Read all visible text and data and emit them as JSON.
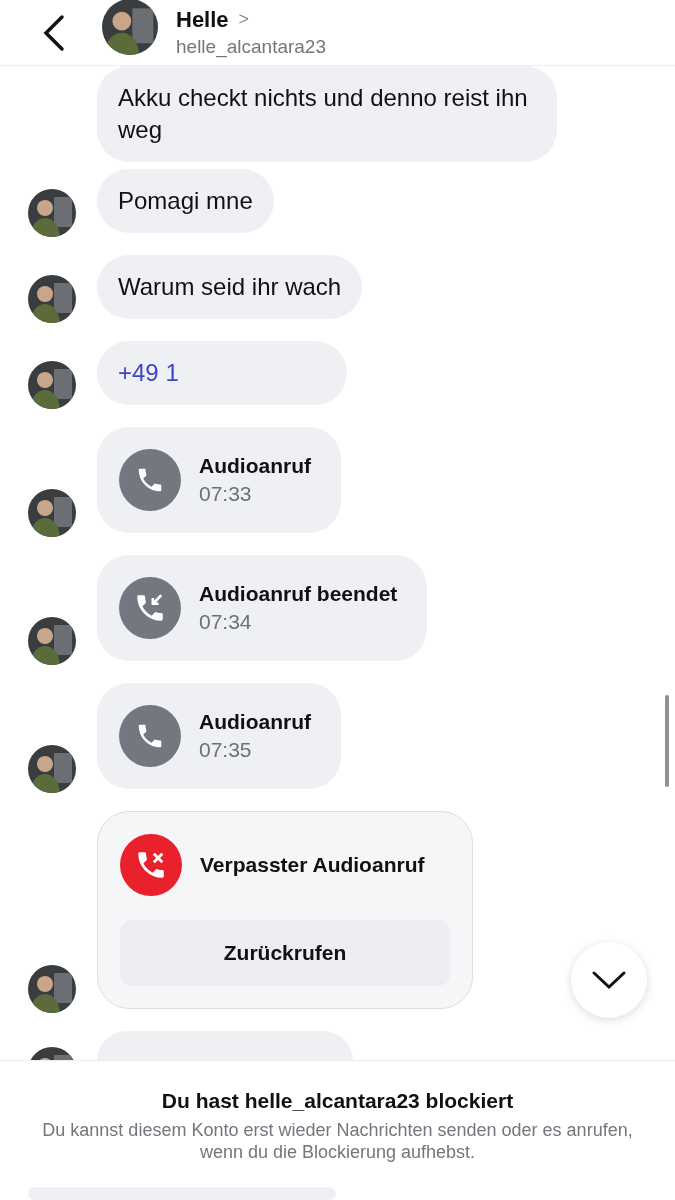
{
  "header": {
    "name": "Helle",
    "chevron": ">",
    "username": "helle_alcantara23"
  },
  "messages": [
    {
      "kind": "text",
      "text": "Akku checkt nichts und denno reist ihn weg",
      "avatar": false
    },
    {
      "kind": "text",
      "text": "Pomagi mne",
      "avatar": true
    },
    {
      "kind": "text",
      "text": "Warum seid ihr wach",
      "avatar": true
    },
    {
      "kind": "link",
      "text": "+49 1",
      "avatar": true
    },
    {
      "kind": "call",
      "title": "Audioanruf",
      "time": "07:33",
      "avatar": true
    },
    {
      "kind": "call_ended",
      "title": "Audioanruf beendet",
      "time": "07:34",
      "avatar": true
    },
    {
      "kind": "call",
      "title": "Audioanruf",
      "time": "07:35",
      "avatar": true
    },
    {
      "kind": "missed_call",
      "title": "Verpasster Audioanruf",
      "action": "Zurückrufen",
      "avatar": true
    },
    {
      "kind": "cut",
      "avatar": true
    }
  ],
  "blocked": {
    "title": "Du hast helle_alcantara23 blockiert",
    "text": "Du kannst diesem Konto erst wieder Nachrichten senden oder es anrufen, wenn du die Blockierung aufhebst."
  }
}
